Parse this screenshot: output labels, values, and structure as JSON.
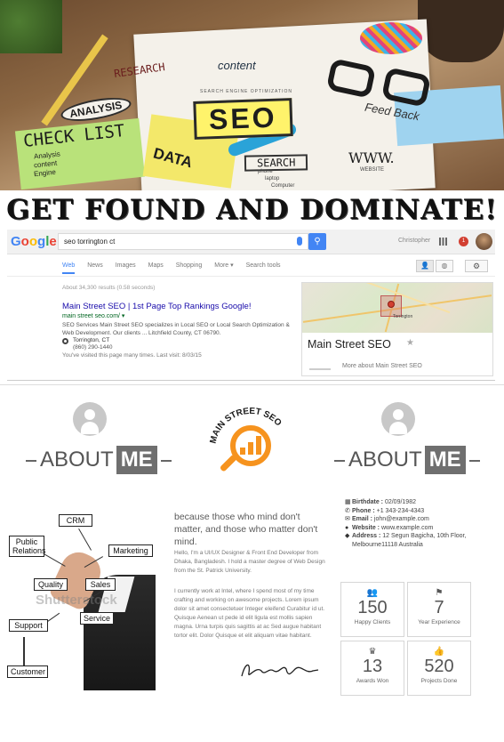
{
  "hero": {
    "analysis": "ANALYSIS",
    "checklist": "CHECK LIST",
    "checklist_items": [
      "Analysis",
      "content",
      "Engine"
    ],
    "research": "RESEARCH",
    "content": "content",
    "search_engine": "SEARCH ENGINE OPTIMIZATION",
    "seo": "SEO",
    "feedback": "Feed Back",
    "data": "DATA",
    "search": "SEARCH",
    "www": "WWW.",
    "devices": [
      "phone",
      "laptop",
      "Computer"
    ],
    "website": "WEBSITE"
  },
  "headline": "GET FOUND AND DOMINATE!",
  "serp": {
    "logo": {
      "G": "G",
      "o1": "o",
      "o2": "o",
      "g": "g",
      "l": "l",
      "e": "e"
    },
    "query": "seo torrington ct",
    "search_button_icon": "search-icon",
    "user_name": "Christopher",
    "notification_count": "1",
    "tabs": [
      "Web",
      "News",
      "Images",
      "Maps",
      "Shopping",
      "More ▾",
      "Search tools"
    ],
    "active_tab": "Web",
    "stats": "About 34,300 results (0.58 seconds)",
    "result": {
      "title": "Main Street SEO | 1st Page Top Rankings Google!",
      "url": "main street seo.com/ ▾",
      "snippet": "SEO Services Main Street SEO specializes in Local SEO or Local Search Optimization & Web Development. Our clients ... Litchfield County, CT 06790.",
      "location": "Torrington, CT",
      "phone": "(860) 290-1440",
      "visited": "You've visited this page many times. Last visit: 8/03/15"
    },
    "panel": {
      "title": "Main Street SEO",
      "map_town": "Torrington",
      "more": "More about Main Street SEO"
    }
  },
  "about": {
    "heading_left": "ABOUT",
    "heading_me": "ME",
    "logo_text": "MAIN STREET SEO",
    "diagram": {
      "crm": "CRM",
      "public_relations": "Public Relations",
      "marketing": "Marketing",
      "quality": "Quality",
      "sales": "Sales",
      "service": "Service",
      "support": "Support",
      "customer": "Customer",
      "watermark": "Shutterstock"
    },
    "quote": "because those who mind don't matter, and those who matter don't mind.",
    "bio1": "Hello, I'm a UI/UX Designer & Front End Developer from Dhaka, Bangladesh. I hold a master degree of Web Design from the St. Patrick University.",
    "bio2": "I currently work at Intel, where I spend most of my time crafting and working on awesome projects. Lorem ipsum dolor sit amet consectetuer Integer eleifend Curabitur id ut. Quisque Aenean ut pede id elit ligula est mollis sapien magna. Urna turpis quis sagittis at ac Sed augue habitant tortor elit. Dolor Quisque et elit aliquam vitae habitant.",
    "info": {
      "birthdate_label": "Birthdate :",
      "birthdate": "02/09/1982",
      "phone_label": "Phone :",
      "phone": "+1 343-234-4343",
      "email_label": "Email :",
      "email": "john@example.com",
      "website_label": "Website :",
      "website": "www.example.com",
      "address_label": "Address :",
      "address1": "12 Segun Bagicha, 10th Floor,",
      "address2": "Melbourne11118 Australia"
    },
    "stats": [
      {
        "icon": "users-icon",
        "value": "150",
        "label": "Happy Clients"
      },
      {
        "icon": "flag-icon",
        "value": "7",
        "label": "Year Experience"
      },
      {
        "icon": "trophy-icon",
        "value": "13",
        "label": "Awards Won"
      },
      {
        "icon": "thumbs-up-icon",
        "value": "520",
        "label": "Projects Done"
      }
    ]
  }
}
